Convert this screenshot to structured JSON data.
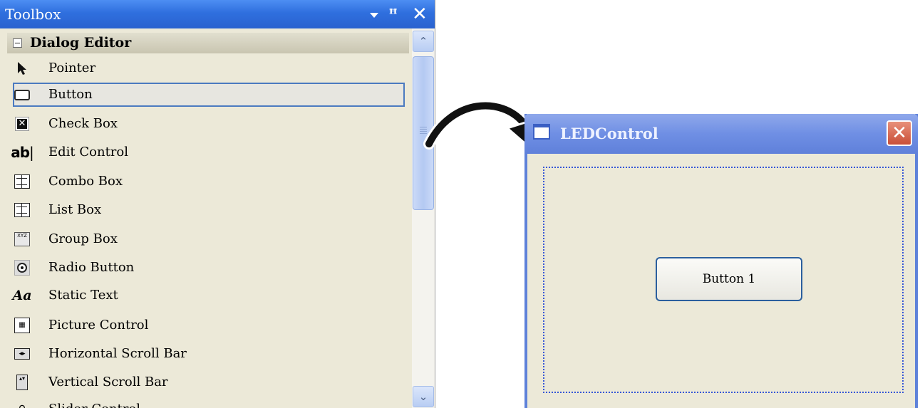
{
  "toolbox": {
    "title": "Toolbox",
    "header_icons": [
      "dropdown-icon",
      "pin-icon",
      "close-icon"
    ],
    "pin_glyph": "ꟸ",
    "close_glyph": "✕",
    "group": {
      "label": "Dialog Editor",
      "expanded": true
    },
    "items": [
      {
        "label": "Pointer",
        "icon": "pointer-icon",
        "glyph": "➤"
      },
      {
        "label": "Button",
        "icon": "button-icon",
        "selected": true
      },
      {
        "label": "Check Box",
        "icon": "check-box-icon",
        "glyph": "✕"
      },
      {
        "label": "Edit Control",
        "icon": "edit-control-icon",
        "glyph": "ab"
      },
      {
        "label": "Combo Box",
        "icon": "combo-box-icon"
      },
      {
        "label": "List Box",
        "icon": "list-box-icon"
      },
      {
        "label": "Group Box",
        "icon": "group-box-icon",
        "glyph": "XYZ"
      },
      {
        "label": "Radio Button",
        "icon": "radio-button-icon"
      },
      {
        "label": "Static Text",
        "icon": "static-text-icon",
        "glyph": "Aa"
      },
      {
        "label": "Picture Control",
        "icon": "picture-control-icon",
        "glyph": "▦"
      },
      {
        "label": "Horizontal Scroll Bar",
        "icon": "horizontal-scroll-bar-icon",
        "glyph": "◂▸"
      },
      {
        "label": "Vertical Scroll Bar",
        "icon": "vertical-scroll-bar-icon",
        "glyph": "▴▾"
      },
      {
        "label": "Slider Control",
        "icon": "slider-control-icon",
        "glyph": "♀"
      }
    ],
    "scrollbar": {
      "up_glyph": "⌃",
      "down_glyph": "⌄"
    }
  },
  "dialog": {
    "title": "LEDControl",
    "close_glyph": "✕",
    "button_label": "Button 1"
  },
  "colors": {
    "toolbox_title_bg": "#2f6fde",
    "selected_border": "#4b7ac0",
    "window_frame": "#5f82d9",
    "dotted_frame": "#3656d6",
    "close_button": "#c94f39"
  }
}
